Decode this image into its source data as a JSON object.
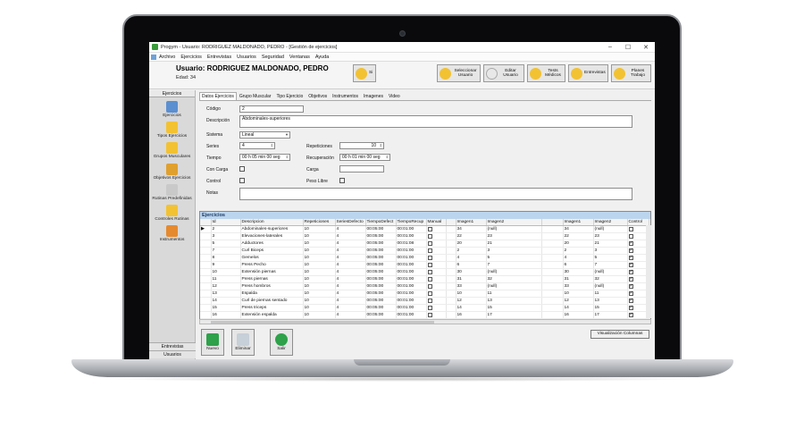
{
  "window": {
    "title": "Progym - Usuario: RODRIGUEZ MALDONADO, PEDRO - [Gestión de ejercicios]"
  },
  "menu": [
    "Archivo",
    "Ejercicios",
    "Entrevistas",
    "Usuarios",
    "Seguridad",
    "Ventanas",
    "Ayuda"
  ],
  "header": {
    "user_title": "Usuario: RODRIGUEZ MALDONADO, PEDRO",
    "edad": "Edad: 34",
    "sexo_btn": "Si",
    "buttons": [
      "Seleccionar Usuario",
      "Editar Usuario",
      "Tests Médicos",
      "Entrevistas",
      "Planes Trabajo"
    ]
  },
  "sidebar": {
    "header": "Ejercicios",
    "items": [
      "Ejercicios",
      "Tipos Ejercicios",
      "Grupos Musculares",
      "Objetivos Ejercicios",
      "Rutinas Predefinidas",
      "Controles Rutinas",
      "Instrumentos"
    ],
    "bottom": [
      "Entrevistas",
      "Usuarios"
    ]
  },
  "tabs": [
    "Datos Ejercicios",
    "Grupo Muscular",
    "Tipo Ejercicio",
    "Objetivos",
    "Instrumentos",
    "Imagenes",
    "Video"
  ],
  "form": {
    "codigo_label": "Código",
    "codigo_value": "2",
    "descripcion_label": "Descripción",
    "descripcion_value": "Abdominales-superiores",
    "sistema_label": "Sistema",
    "sistema_value": "Lineal",
    "series_label": "Series",
    "series_value": "4",
    "repeticiones_label": "Repeticiones",
    "repeticiones_value": "10",
    "tiempo_label": "Tiempo",
    "tiempo_value": "00 h 05 min 00 seg",
    "recuperacion_label": "Recuperación",
    "recuperacion_value": "00 h 01 min 00 seg",
    "concarga_label": "Con Carga",
    "carga_label": "Carga",
    "control_label": "Control",
    "pesolibre_label": "Peso Libre",
    "notas_label": "Notas"
  },
  "grid": {
    "title": "Ejercicios",
    "columns": [
      "",
      "Id",
      "Descripcion",
      "Repeticiones",
      "SeriesDefecto",
      "TiempoDefect",
      "TiempoRecup",
      "Manual",
      "",
      "Imagen1",
      "Imagen2",
      "",
      "Imagen1",
      "Imagen2",
      "Control",
      ""
    ],
    "rows": [
      {
        "mark": "▶",
        "id": "2",
        "desc": "Abdominales-superiores",
        "rep": "10",
        "ser": "4",
        "tdef": "00:05:00",
        "trec": "00:01:00",
        "man": false,
        "im1": "34",
        "im2": "(null)",
        "im1b": "34",
        "im2b": "(null)",
        "ctl": false
      },
      {
        "mark": "",
        "id": "3",
        "desc": "Elevaciones-laterales",
        "rep": "10",
        "ser": "4",
        "tdef": "00:05:00",
        "trec": "00:01:00",
        "man": false,
        "im1": "22",
        "im2": "23",
        "im1b": "22",
        "im2b": "23",
        "ctl": false
      },
      {
        "mark": "",
        "id": "5",
        "desc": "Adductores",
        "rep": "10",
        "ser": "4",
        "tdef": "00:05:00",
        "trec": "00:01:08",
        "man": false,
        "im1": "20",
        "im2": "21",
        "im1b": "20",
        "im2b": "21",
        "ctl": true
      },
      {
        "mark": "",
        "id": "7",
        "desc": "Curl Biceps",
        "rep": "10",
        "ser": "4",
        "tdef": "00:05:00",
        "trec": "00:01:00",
        "man": false,
        "im1": "2",
        "im2": "3",
        "im1b": "2",
        "im2b": "3",
        "ctl": true
      },
      {
        "mark": "",
        "id": "8",
        "desc": "Gemelos",
        "rep": "10",
        "ser": "4",
        "tdef": "00:05:00",
        "trec": "00:01:00",
        "man": false,
        "im1": "4",
        "im2": "5",
        "im1b": "4",
        "im2b": "5",
        "ctl": true
      },
      {
        "mark": "",
        "id": "9",
        "desc": "Press Pecho",
        "rep": "10",
        "ser": "4",
        "tdef": "00:05:00",
        "trec": "00:01:00",
        "man": false,
        "im1": "6",
        "im2": "7",
        "im1b": "6",
        "im2b": "7",
        "ctl": true
      },
      {
        "mark": "",
        "id": "10",
        "desc": "Extensión piernas",
        "rep": "10",
        "ser": "4",
        "tdef": "00:05:00",
        "trec": "00:01:00",
        "man": false,
        "im1": "30",
        "im2": "(null)",
        "im1b": "30",
        "im2b": "(null)",
        "ctl": true
      },
      {
        "mark": "",
        "id": "11",
        "desc": "Press piernas",
        "rep": "10",
        "ser": "4",
        "tdef": "00:05:00",
        "trec": "00:01:00",
        "man": false,
        "im1": "31",
        "im2": "32",
        "im1b": "31",
        "im2b": "32",
        "ctl": true
      },
      {
        "mark": "",
        "id": "12",
        "desc": "Press hombros",
        "rep": "10",
        "ser": "4",
        "tdef": "00:05:00",
        "trec": "00:01:00",
        "man": false,
        "im1": "33",
        "im2": "(null)",
        "im1b": "33",
        "im2b": "(null)",
        "ctl": true
      },
      {
        "mark": "",
        "id": "13",
        "desc": "Espalda",
        "rep": "10",
        "ser": "4",
        "tdef": "00:05:00",
        "trec": "00:01:00",
        "man": false,
        "im1": "10",
        "im2": "11",
        "im1b": "10",
        "im2b": "11",
        "ctl": true
      },
      {
        "mark": "",
        "id": "14",
        "desc": "Curl de piernas sentado",
        "rep": "10",
        "ser": "4",
        "tdef": "00:05:00",
        "trec": "00:01:00",
        "man": false,
        "im1": "12",
        "im2": "13",
        "im1b": "12",
        "im2b": "13",
        "ctl": true
      },
      {
        "mark": "",
        "id": "15",
        "desc": "Press triceps",
        "rep": "10",
        "ser": "4",
        "tdef": "00:05:00",
        "trec": "00:01:00",
        "man": false,
        "im1": "14",
        "im2": "15",
        "im1b": "14",
        "im2b": "15",
        "ctl": true
      },
      {
        "mark": "",
        "id": "16",
        "desc": "Extensión espalda",
        "rep": "10",
        "ser": "4",
        "tdef": "00:05:00",
        "trec": "00:01:00",
        "man": false,
        "im1": "16",
        "im2": "17",
        "im1b": "16",
        "im2b": "17",
        "ctl": true
      }
    ]
  },
  "bottom_buttons": {
    "nuevo": "Nuevo",
    "eliminar": "Eliminar",
    "salir": "Salir",
    "visualizacion": "Visualización Columnas"
  },
  "colors": {
    "icon_yellow": "#f2c233",
    "icon_green": "#2ea14a",
    "grid_title_bg": "#bcd5ee",
    "frame": "#0a0a0c"
  },
  "icons": [
    "app-icon",
    "smiley-icon",
    "exercise-icon",
    "person-icon",
    "book-icon",
    "exit-icon",
    "trash-icon"
  ]
}
